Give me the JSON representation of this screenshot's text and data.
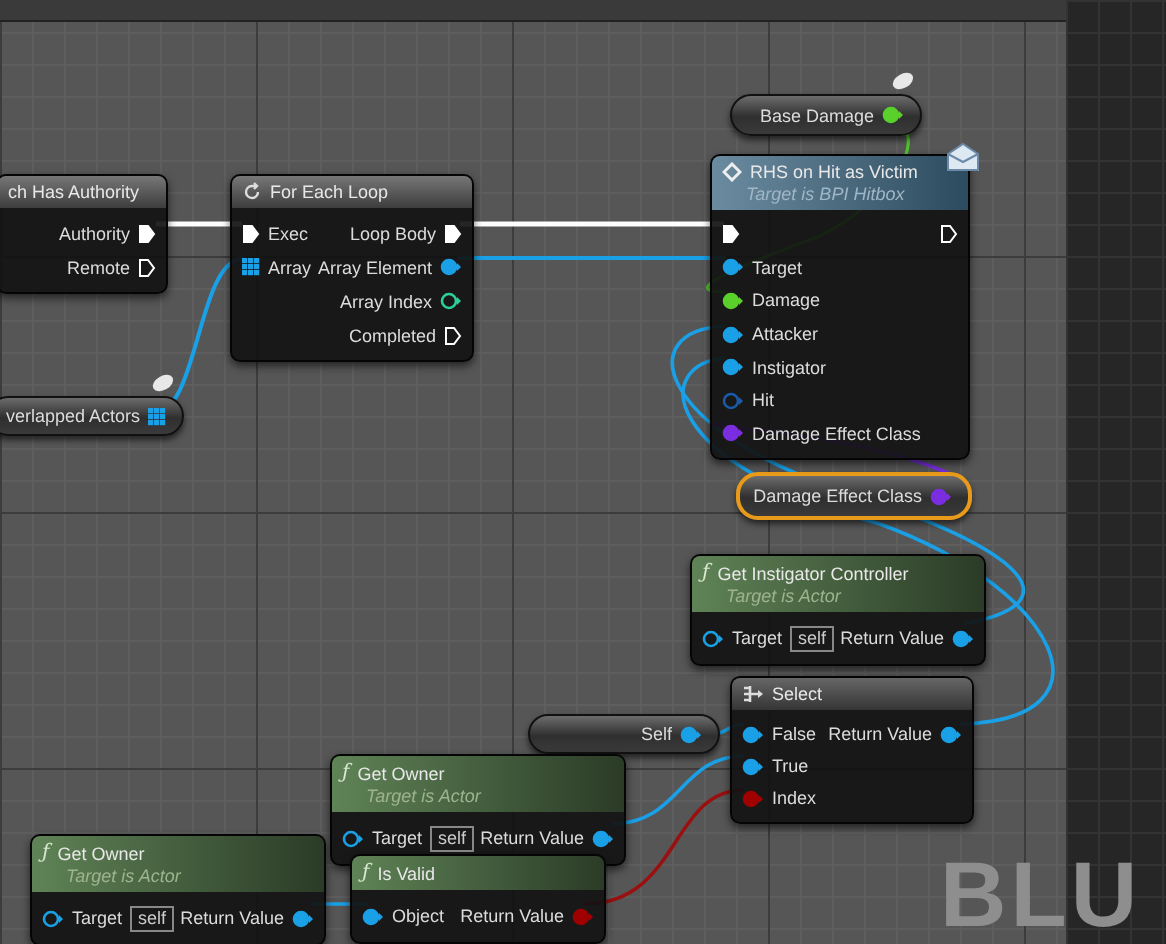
{
  "graph": {
    "nodes": [
      {
        "kind": "macro",
        "title": "ch Has Authority",
        "outputs": [
          {
            "label": "Authority",
            "kind": "exec",
            "connected": true
          },
          {
            "label": "Remote",
            "kind": "exec",
            "connected": false
          }
        ]
      },
      {
        "kind": "loop",
        "title": "For Each Loop",
        "inputs": [
          {
            "label": "Exec",
            "kind": "exec",
            "connected": true
          },
          {
            "label": "Array",
            "kind": "array",
            "connected": true,
            "color": "#1aa0e6"
          }
        ],
        "outputs": [
          {
            "label": "Loop Body",
            "kind": "exec",
            "connected": true
          },
          {
            "label": "Array Element",
            "kind": "data",
            "connected": true,
            "color": "#1aa0e6"
          },
          {
            "label": "Array Index",
            "kind": "data",
            "connected": false,
            "color": "#2ccf9a"
          },
          {
            "label": "Completed",
            "kind": "exec",
            "connected": false
          }
        ]
      },
      {
        "kind": "message",
        "title": "RHS on Hit as Victim",
        "subtitle": "Target is BPI Hitbox",
        "inputs": [
          {
            "kind": "exec",
            "connected": true
          },
          {
            "label": "Target",
            "kind": "data",
            "connected": true,
            "color": "#1aa0e6"
          },
          {
            "label": "Damage",
            "kind": "data",
            "connected": true,
            "color": "#5ad12a"
          },
          {
            "label": "Attacker",
            "kind": "data",
            "connected": true,
            "color": "#1aa0e6"
          },
          {
            "label": "Instigator",
            "kind": "data",
            "connected": true,
            "color": "#1aa0e6"
          },
          {
            "label": "Hit",
            "kind": "data",
            "connected": false,
            "color": "#1a5aa8"
          },
          {
            "label": "Damage Effect Class",
            "kind": "data",
            "connected": true,
            "color": "#7a2ee0"
          }
        ],
        "outputs": [
          {
            "kind": "exec",
            "connected": false
          }
        ]
      },
      {
        "kind": "function",
        "icon": "ƒ",
        "title": "Get Instigator Controller",
        "subtitle": "Target is Actor",
        "inputs": [
          {
            "label": "Target",
            "kind": "data",
            "connected": false,
            "color": "#1aa0e6",
            "default": "self"
          }
        ],
        "outputs": [
          {
            "label": "Return Value",
            "kind": "data",
            "connected": true,
            "color": "#1aa0e6"
          }
        ]
      },
      {
        "kind": "select",
        "title": "Select",
        "inputs": [
          {
            "label": "False",
            "kind": "data",
            "connected": true,
            "color": "#1aa0e6"
          },
          {
            "label": "True",
            "kind": "data",
            "connected": true,
            "color": "#1aa0e6"
          },
          {
            "label": "Index",
            "kind": "data",
            "connected": true,
            "color": "#a00000"
          }
        ],
        "outputs": [
          {
            "label": "Return Value",
            "kind": "data",
            "connected": true,
            "color": "#1aa0e6"
          }
        ]
      },
      {
        "kind": "function",
        "icon": "ƒ",
        "title": "Get Owner",
        "subtitle": "Target is Actor",
        "inputs": [
          {
            "label": "Target",
            "kind": "data",
            "connected": false,
            "color": "#1aa0e6",
            "default": "self"
          }
        ],
        "outputs": [
          {
            "label": "Return Value",
            "kind": "data",
            "connected": true,
            "color": "#1aa0e6"
          }
        ]
      },
      {
        "kind": "function",
        "icon": "ƒ",
        "title": "Get Owner",
        "subtitle": "Target is Actor",
        "inputs": [
          {
            "label": "Target",
            "kind": "data",
            "connected": false,
            "color": "#1aa0e6",
            "default": "self"
          }
        ],
        "outputs": [
          {
            "label": "Return Value",
            "kind": "data",
            "connected": true,
            "color": "#1aa0e6"
          }
        ]
      },
      {
        "kind": "function",
        "icon": "ƒ",
        "title": "Is Valid",
        "inputs": [
          {
            "label": "Object",
            "kind": "data",
            "connected": true,
            "color": "#1aa0e6"
          }
        ],
        "outputs": [
          {
            "label": "Return Value",
            "kind": "data",
            "connected": true,
            "color": "#a00000"
          }
        ]
      }
    ],
    "variables": [
      {
        "label": "verlapped Actors",
        "kind": "array",
        "color": "#1aa0e6",
        "selected": false
      },
      {
        "label": "Base Damage",
        "kind": "data",
        "color": "#5ad12a",
        "selected": false
      },
      {
        "label": "Damage Effect Class",
        "kind": "data",
        "color": "#7a2ee0",
        "selected": true
      },
      {
        "label": "Self",
        "kind": "data",
        "color": "#1aa0e6",
        "selected": false
      }
    ],
    "watermark": "BLU"
  }
}
